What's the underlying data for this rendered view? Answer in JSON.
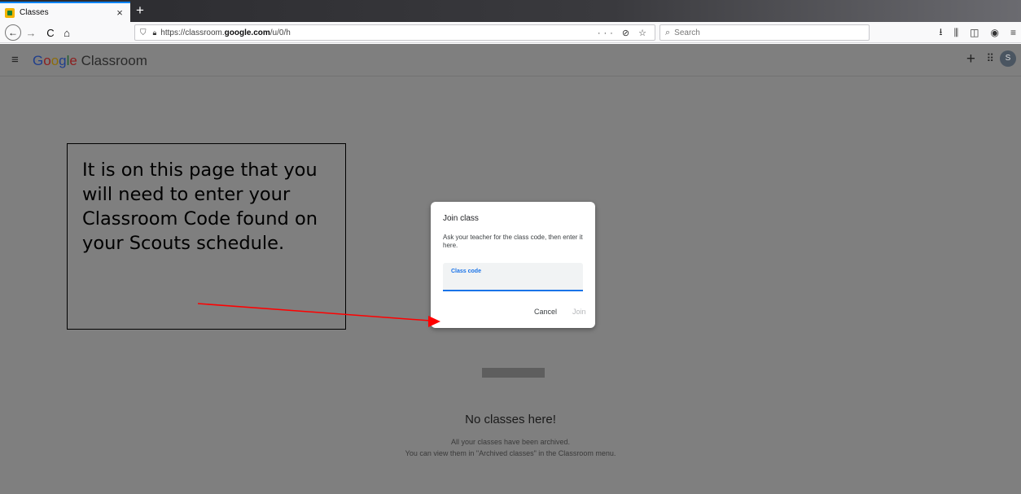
{
  "browser": {
    "tab_title": "Classes",
    "tab_close": "×",
    "new_tab": "+",
    "url_prefix": "https://classroom.",
    "url_host": "google.com",
    "url_path": "/u/0/h",
    "url_actions": "··· ⊘ ☆",
    "search_placeholder": "Search",
    "nav_icons": {
      "back": "←",
      "forward": "→",
      "reload": "C",
      "home": "⌂"
    },
    "right_icons": {
      "download": "⭳",
      "library": "⫼",
      "sidebar": "◫",
      "account": "◉",
      "menu": "≡"
    }
  },
  "app": {
    "menu_icon": "≡",
    "logo_letters": [
      "G",
      "o",
      "o",
      "g",
      "l",
      "e"
    ],
    "logo_product": " Classroom",
    "plus_icon": "+",
    "apps_icon": "⠿",
    "avatar_letter": "S"
  },
  "empty_state": {
    "title": "No classes here!",
    "line1": "All your classes have been archived.",
    "line2": "You can view them in \"Archived classes\" in the Classroom menu."
  },
  "dialog": {
    "title": "Join class",
    "description": "Ask your teacher for the class code, then enter it here.",
    "field_label": "Class code",
    "field_value": "",
    "cancel_label": "Cancel",
    "join_label": "Join"
  },
  "callout": {
    "text": "It is on this page that you will need to enter your Classroom Code found on your Scouts schedule."
  },
  "colors": {
    "overlay_gray": "#7f7f7f",
    "accent_blue": "#1a73e8",
    "arrow_red": "#ff0000"
  }
}
